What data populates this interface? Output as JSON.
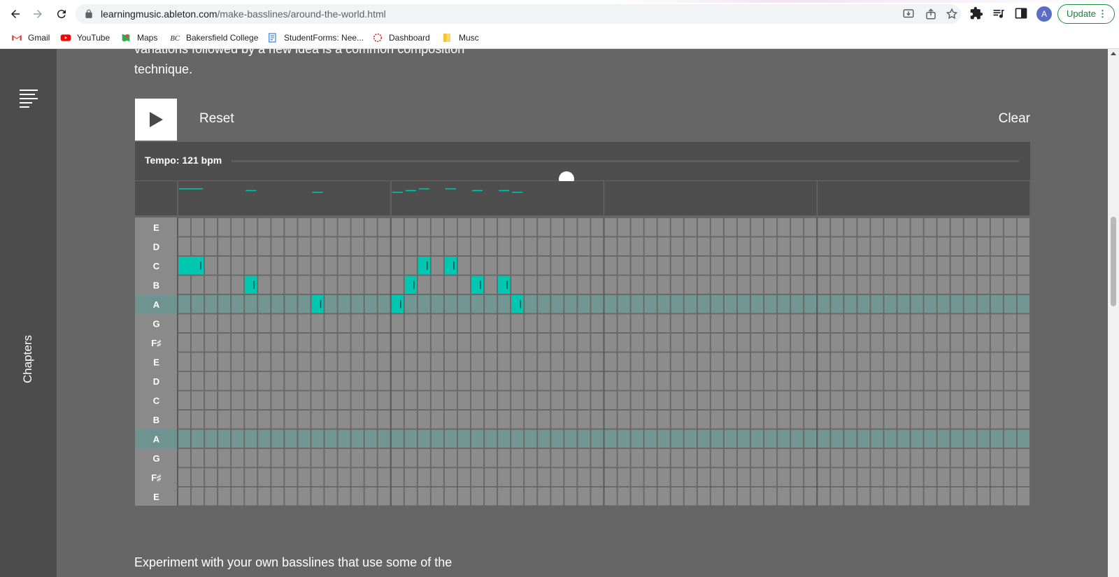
{
  "browser": {
    "url_host": "learningmusic.ableton.com",
    "url_path": "/make-basslines/around-the-world.html",
    "avatar_letter": "A",
    "update_label": "Update",
    "bookmarks": [
      {
        "label": "Gmail",
        "icon": "gmail-icon"
      },
      {
        "label": "YouTube",
        "icon": "youtube-icon"
      },
      {
        "label": "Maps",
        "icon": "maps-icon"
      },
      {
        "label": "Bakersfield College",
        "icon": "bc-icon"
      },
      {
        "label": "StudentForms: Nee...",
        "icon": "forms-icon"
      },
      {
        "label": "Dashboard",
        "icon": "dashboard-icon"
      },
      {
        "label": "Musc",
        "icon": "folder-icon"
      }
    ]
  },
  "page": {
    "cut_text_line1": "variations followed by a new idea is a common composition",
    "cut_text_line2": "technique.",
    "bottom_text": "Experiment with your own basslines that use some of the",
    "chapters_label": "Chapters"
  },
  "app": {
    "reset_label": "Reset",
    "clear_label": "Clear",
    "tempo_label": "Tempo: 121 bpm",
    "tempo_fraction": 0.425,
    "accent_color": "#00c7b1",
    "rows": [
      "E",
      "D",
      "C",
      "B",
      "A",
      "G",
      "F♯",
      "E",
      "D",
      "C",
      "B",
      "A",
      "G",
      "F♯",
      "E"
    ],
    "highlight_rows": [
      4,
      11
    ],
    "steps": 64,
    "steps_per_bar": 16,
    "notes": [
      {
        "row": 2,
        "step": 0,
        "length": 2
      },
      {
        "row": 3,
        "step": 5,
        "length": 1
      },
      {
        "row": 4,
        "step": 10,
        "length": 1
      },
      {
        "row": 4,
        "step": 16,
        "length": 1
      },
      {
        "row": 3,
        "step": 17,
        "length": 1
      },
      {
        "row": 2,
        "step": 18,
        "length": 1
      },
      {
        "row": 2,
        "step": 20,
        "length": 1
      },
      {
        "row": 3,
        "step": 22,
        "length": 1
      },
      {
        "row": 3,
        "step": 24,
        "length": 1
      },
      {
        "row": 4,
        "step": 25,
        "length": 1
      }
    ]
  }
}
